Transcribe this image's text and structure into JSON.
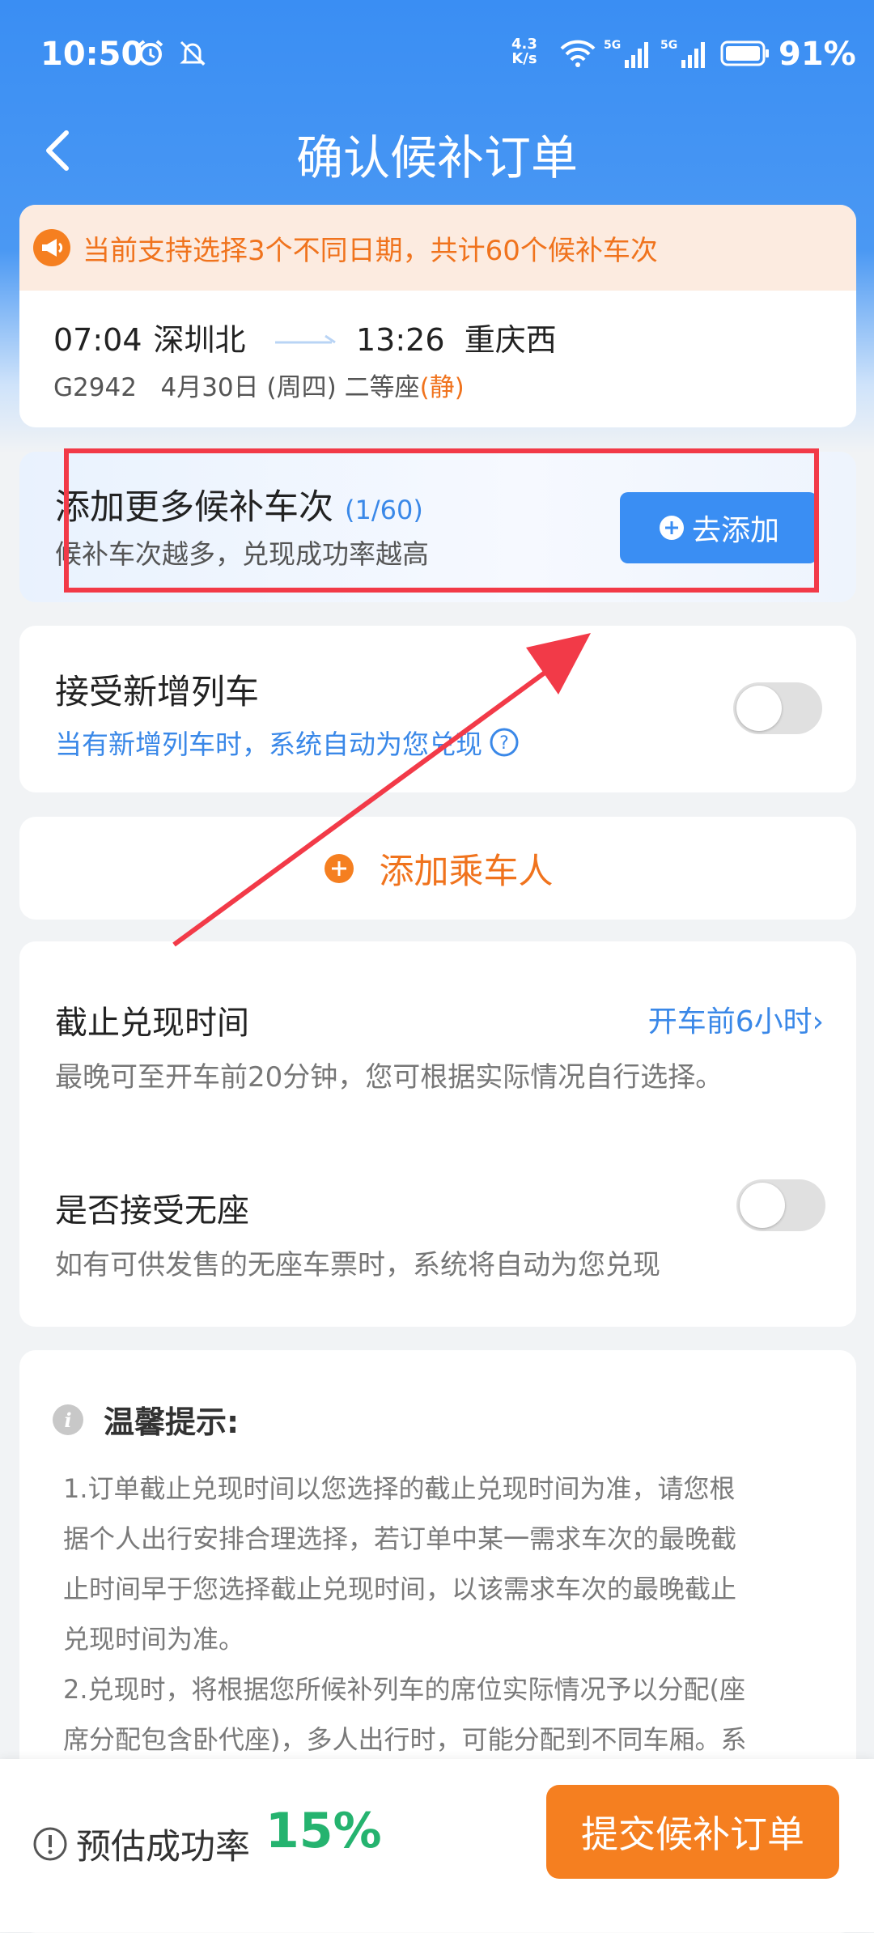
{
  "status_bar": {
    "time": "10:50",
    "net_speed_value": "4.3",
    "net_speed_unit": "K/s",
    "signal1_label": "5G",
    "signal2_label": "5G",
    "battery": "91%"
  },
  "header": {
    "title": "确认候补订单"
  },
  "trip": {
    "notice": "当前支持选择3个不同日期，共计60个候补车次",
    "depart_time": "07:04",
    "depart_station": "深圳北",
    "arrive_time": "13:26",
    "arrive_station": "重庆西",
    "train_no": "G2942",
    "date": "4月30日 (周四)",
    "seat_class": "二等座",
    "seat_tag": "(静)"
  },
  "add_more": {
    "title": "添加更多候补车次",
    "count": "(1/60)",
    "subtitle": "候补车次越多，兑现成功率越高",
    "button": "去添加"
  },
  "accept_new": {
    "title": "接受新增列车",
    "desc": "当有新增列车时，系统自动为您兑现",
    "enabled": false
  },
  "add_passenger": {
    "label": "添加乘车人"
  },
  "deadline": {
    "label": "截止兑现时间",
    "value": "开车前6小时",
    "desc": "最晚可至开车前20分钟，您可根据实际情况自行选择。"
  },
  "no_seat": {
    "label": "是否接受无座",
    "desc": "如有可供发售的无座车票时，系统将自动为您兑现",
    "enabled": false
  },
  "tips": {
    "title": "温馨提示:",
    "lines": [
      "1.订单截止兑现时间以您选择的截止兑现时间为准，请您根",
      "据个人出行安排合理选择，若订单中某一需求车次的最晚截",
      "止时间早于您选择截止兑现时间，以该需求车次的最晚截止",
      "兑现时间为准。",
      "2.兑现时，将根据您所候补列车的席位实际情况予以分配(座",
      "席分配包含卧代座)，多人出行时，可能分配到不同车厢。系"
    ]
  },
  "bottom": {
    "estimate_label": "预估成功率",
    "rate": "15%",
    "submit": "提交候补订单"
  },
  "colors": {
    "primary_blue": "#3a8ef3",
    "accent_orange": "#f57f20",
    "success_green": "#25b36f",
    "highlight_red": "#f23a48"
  }
}
